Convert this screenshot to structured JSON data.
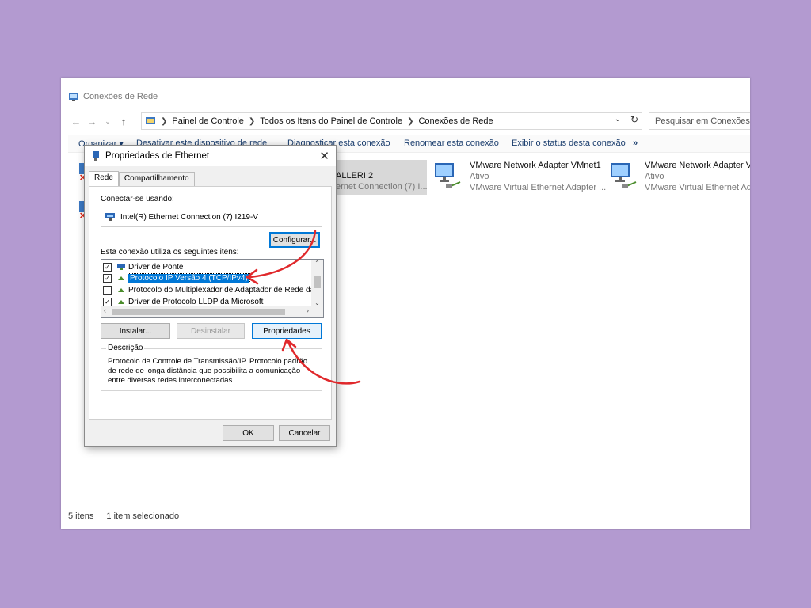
{
  "window": {
    "title": "Conexões de Rede",
    "nav": {
      "back": "←",
      "forward": "→",
      "up": "↑"
    },
    "breadcrumbs": [
      "Painel de Controle",
      "Todos os Itens do Painel de Controle",
      "Conexões de Rede"
    ],
    "search_placeholder": "Pesquisar em Conexões de Rede"
  },
  "toolbar": {
    "organize": "Organizar ▾",
    "disable": "Desativar este dispositivo de rede",
    "diagnose": "Diagnosticar esta conexão",
    "rename": "Renomear esta conexão",
    "status": "Exibir o status desta conexão",
    "more": "»"
  },
  "network_items": [
    {
      "name": "ALLERI 2",
      "detail": "ernet Connection (7) I..."
    },
    {
      "name": "VMware Network Adapter VMnet1",
      "status": "Ativo",
      "detail": "VMware Virtual Ethernet Adapter ..."
    },
    {
      "name": "VMware Network Adapter VM",
      "status": "Ativo",
      "detail": "VMware Virtual Ethernet Ada"
    }
  ],
  "statusbar": {
    "count": "5 itens",
    "selected": "1 item selecionado"
  },
  "dialog": {
    "title": "Propriedades de Ethernet",
    "tabs": [
      "Rede",
      "Compartilhamento"
    ],
    "connect_using_label": "Conectar-se usando:",
    "adapter": "Intel(R) Ethernet Connection (7) I219-V",
    "configure_button": "Configurar...",
    "items_label": "Esta conexão utiliza os seguintes itens:",
    "items": [
      {
        "checked": true,
        "label": "Driver de Ponte"
      },
      {
        "checked": true,
        "label": "Protocolo IP Versão 4 (TCP/IPv4)",
        "selected": true
      },
      {
        "checked": false,
        "label": "Protocolo do Multiplexador de Adaptador de Rede da M"
      },
      {
        "checked": true,
        "label": "Driver de Protocolo LLDP da Microsoft"
      }
    ],
    "install_button": "Instalar...",
    "uninstall_button": "Desinstalar",
    "properties_button": "Propriedades",
    "description_label": "Descrição",
    "description_text": "Protocolo de Controle de Transmissão/IP. Protocolo padrão de rede de longa distância que possibilita a comunicação entre diversas redes interconectadas.",
    "ok_button": "OK",
    "cancel_button": "Cancelar"
  },
  "colors": {
    "background": "#b39ad0",
    "accent": "#0078d7",
    "annotation_arrow": "#e0282b"
  }
}
